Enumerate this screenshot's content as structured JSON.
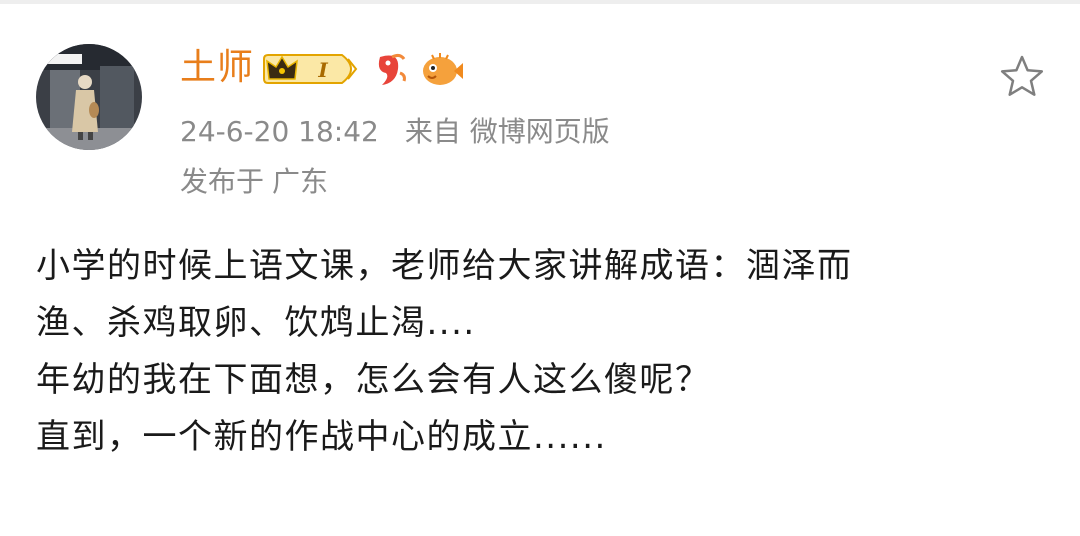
{
  "post": {
    "author": {
      "name": "土师",
      "level_badge": "I",
      "avatar_icon": "avatar-photo-icon",
      "badge_icons": [
        "crown-level-badge-icon",
        "red-bird-badge-icon",
        "puffer-fish-badge-icon"
      ]
    },
    "meta": {
      "date": "24-6-20 18:42",
      "source": "来自 微博网页版",
      "location_prefix": "发布于",
      "location": "广东"
    },
    "favorite_icon": "star-outline-icon",
    "body_lines": [
      "小学的时候上语文课，老师给大家讲解成语：涸泽而",
      "渔、杀鸡取卵、饮鸩止渴....",
      "年幼的我在下面想，怎么会有人这么傻呢？",
      "直到，一个新的作战中心的成立......"
    ]
  },
  "colors": {
    "username": "#e87e1b",
    "meta": "#8a8a8a",
    "body_text": "#1a1a1a",
    "background": "#ffffff"
  }
}
